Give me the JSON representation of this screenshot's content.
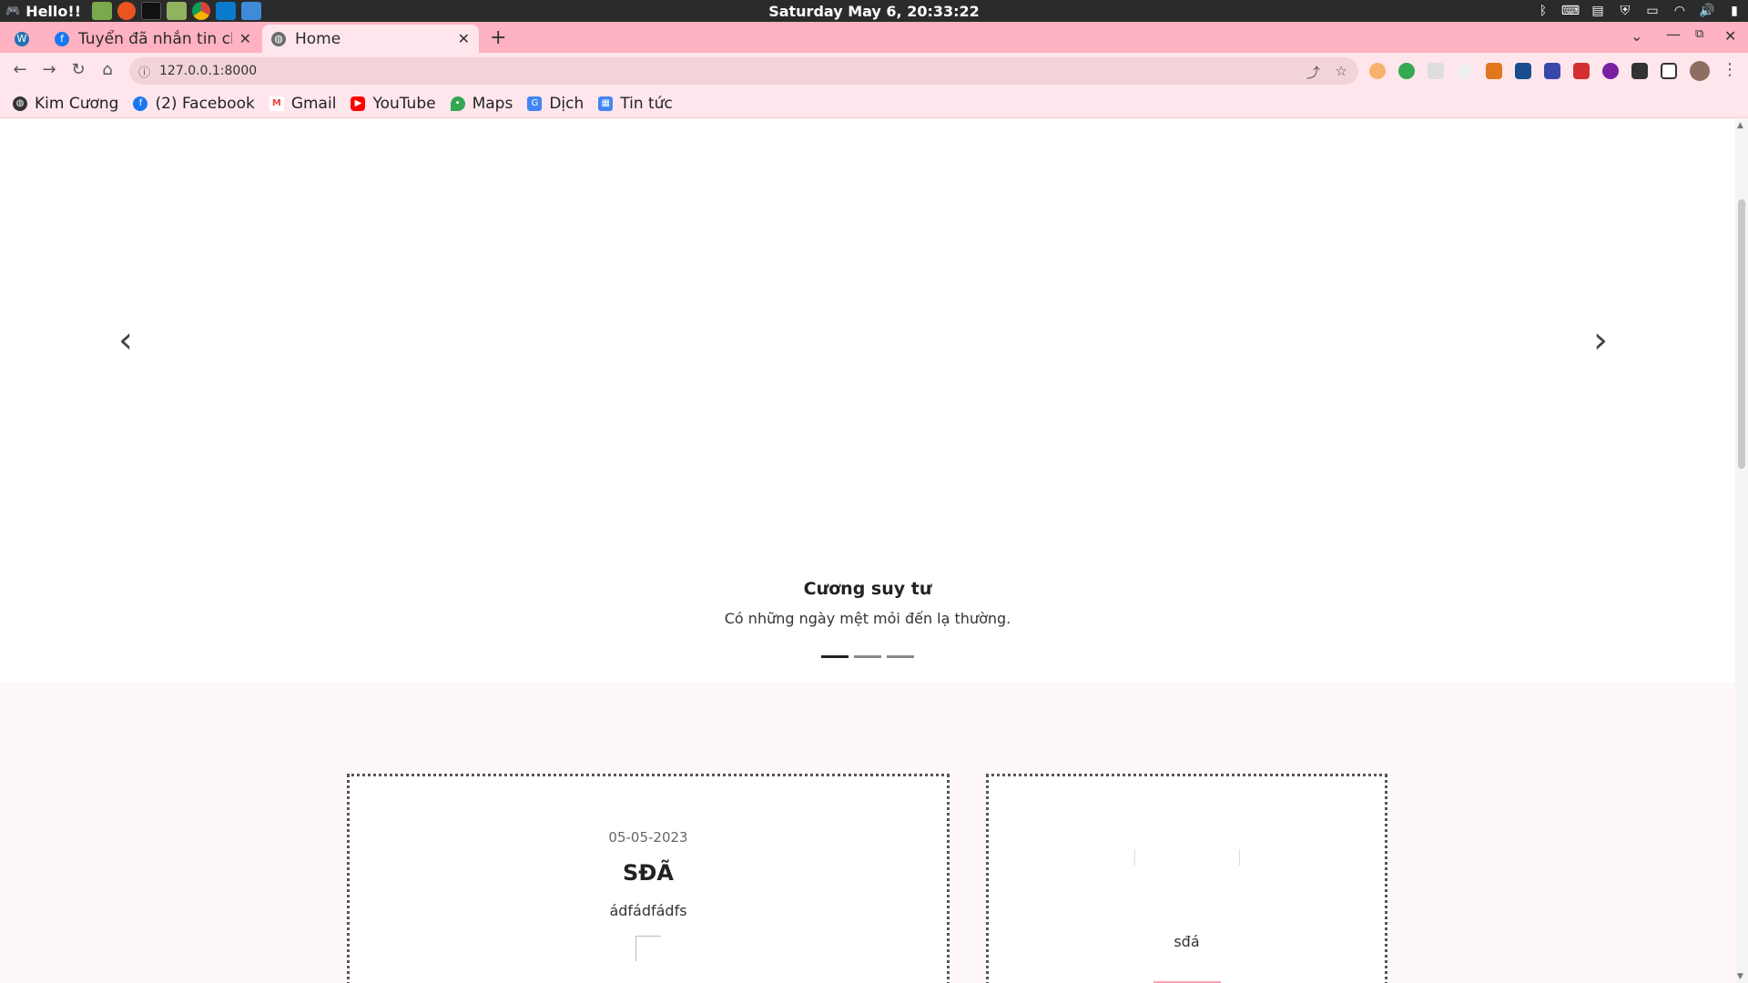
{
  "os": {
    "greeting": "Hello!!",
    "clock": "Saturday May  6, 20:33:22",
    "apps": [
      "files-app-icon",
      "ubuntu-software-icon",
      "terminal-icon",
      "folder-icon",
      "chrome-icon",
      "vscode-icon",
      "chat-icon"
    ],
    "tray": [
      "bluetooth-icon",
      "keyboard-icon",
      "clipboard-icon",
      "shield-icon",
      "notes-icon",
      "wifi-icon",
      "volume-icon",
      "battery-icon"
    ]
  },
  "browser": {
    "tabs": [
      {
        "title": "",
        "favicon": "wordpress-icon",
        "color": "#2271b1"
      },
      {
        "title": "Tuyển đã nhắn tin cho",
        "favicon": "facebook-icon",
        "color": "#1877f2",
        "close": "✕"
      },
      {
        "title": "Home",
        "favicon": "globe-icon",
        "color": "#5f6368",
        "close": "✕",
        "active": true
      }
    ],
    "new_tab": "+",
    "url": "127.0.0.1:8000",
    "bookmarks": [
      {
        "label": "Kim Cương",
        "icon": "globe-icon",
        "color": "#333333"
      },
      {
        "label": "(2) Facebook",
        "icon": "facebook-icon",
        "color": "#1877f2"
      },
      {
        "label": "Gmail",
        "icon": "gmail-icon",
        "color": "#ea4335"
      },
      {
        "label": "YouTube",
        "icon": "youtube-icon",
        "color": "#ff0000"
      },
      {
        "label": "Maps",
        "icon": "maps-icon",
        "color": "#34a853"
      },
      {
        "label": "Dịch",
        "icon": "translate-icon",
        "color": "#4285f4"
      },
      {
        "label": "Tin tức",
        "icon": "news-icon",
        "color": "#4285f4"
      }
    ]
  },
  "page": {
    "carousel": {
      "title": "Cương suy tư",
      "text": "Có những ngày mệt mỏi đến lạ thường.",
      "slides": 3,
      "active_slide": 1
    },
    "posts": [
      {
        "date": "05-05-2023",
        "title": "SĐÃ",
        "description": "ádfádfádfs"
      },
      {
        "description": "sđá"
      }
    ]
  }
}
